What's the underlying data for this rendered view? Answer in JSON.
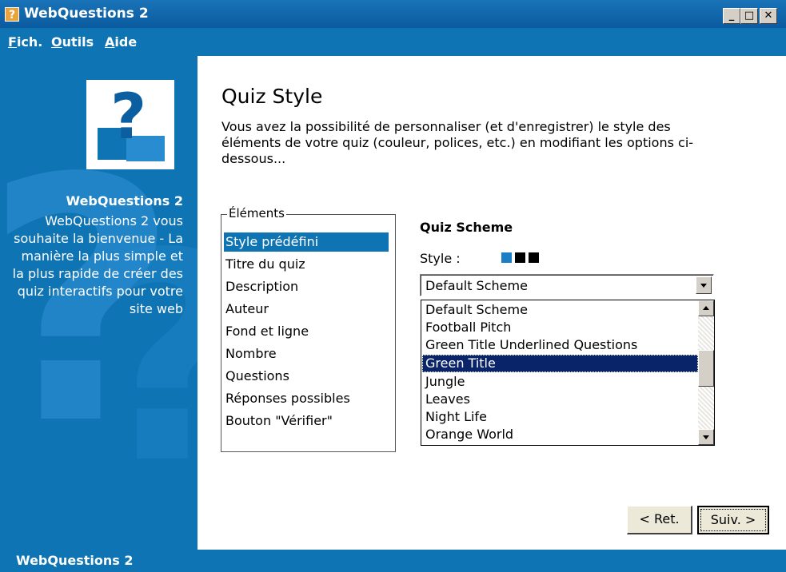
{
  "window": {
    "title": "WebQuestions 2",
    "icon_glyph": "?",
    "controls": {
      "minimize": "_",
      "maximize": "□",
      "close": "✕"
    }
  },
  "menu": {
    "items": [
      "Fich.",
      "Outils",
      "Aide"
    ]
  },
  "sidebar": {
    "logo_glyph": "?",
    "title": "WebQuestions 2",
    "body": "WebQuestions 2 vous souhaite la bienvenue - La manière la plus simple et la plus rapide de créer des quiz interactifs pour votre site web",
    "footer": "WebQuestions 2",
    "colors": {
      "panel": "#0e74b4",
      "watermark": "#2a8cd0"
    }
  },
  "main": {
    "title": "Quiz Style",
    "description": "Vous avez la possibilité de personnaliser (et d'enregistrer) le style des éléments de votre quiz (couleur, polices, etc.) en modifiant les options ci-dessous...",
    "elements": {
      "legend": "Éléments",
      "items": [
        {
          "label": "Style prédéfini",
          "selected": true
        },
        {
          "label": "Titre du quiz",
          "selected": false
        },
        {
          "label": "Description",
          "selected": false
        },
        {
          "label": "Auteur",
          "selected": false
        },
        {
          "label": "Fond et ligne",
          "selected": false
        },
        {
          "label": "Nombre",
          "selected": false
        },
        {
          "label": "Questions",
          "selected": false
        },
        {
          "label": "Réponses possibles",
          "selected": false
        },
        {
          "label": "Bouton \"Vérifier\"",
          "selected": false
        }
      ]
    },
    "scheme": {
      "heading": "Quiz Scheme",
      "style_label": "Style :",
      "swatches": [
        "#1a7fc4",
        "#000000",
        "#000000"
      ],
      "selected_value": "Default Scheme",
      "options": [
        "Default Scheme",
        "Football Pitch",
        "Green Title Underlined Questions",
        "Green Title",
        "Jungle",
        "Leaves",
        "Night Life",
        "Orange World"
      ],
      "highlighted_index": 3
    },
    "buttons": {
      "back": "< Ret.",
      "next": "Suiv. >"
    }
  }
}
